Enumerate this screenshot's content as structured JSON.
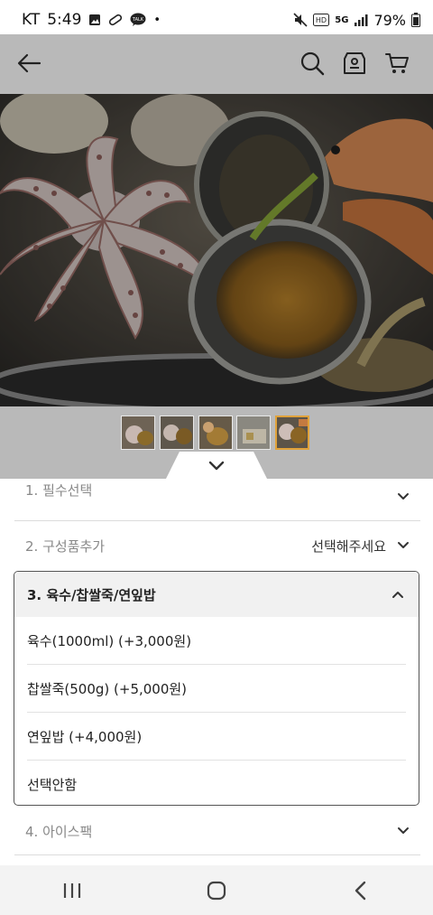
{
  "status_bar": {
    "carrier": "KT",
    "time": "5:49",
    "dot": "•",
    "talk_label": "TALK",
    "network": "5G",
    "hd_label": "HD",
    "battery": "79%"
  },
  "product": {
    "image_icons": [
      "arrow-left-icon",
      "search-icon",
      "store-icon",
      "cart-icon"
    ]
  },
  "options_sheet": {
    "option1_label": "1. 필수선택",
    "option2_label": "2. 구성품추가",
    "option2_value": "선택해주세요",
    "option3_label": "3. 육수/찹쌀죽/연잎밥",
    "option3_choices": [
      "육수(1000ml) (+3,000원)",
      "찹쌀죽(500g) (+5,000원)",
      "연잎밥 (+4,000원)",
      "선택안함"
    ],
    "option4_label": "4. 아이스팩"
  },
  "thumbnails": {
    "count": 5,
    "selected_index": 4
  },
  "colors": {
    "overlay": "#b9b9b9",
    "accent_border": "#e0a23a",
    "text_muted": "#888888"
  }
}
